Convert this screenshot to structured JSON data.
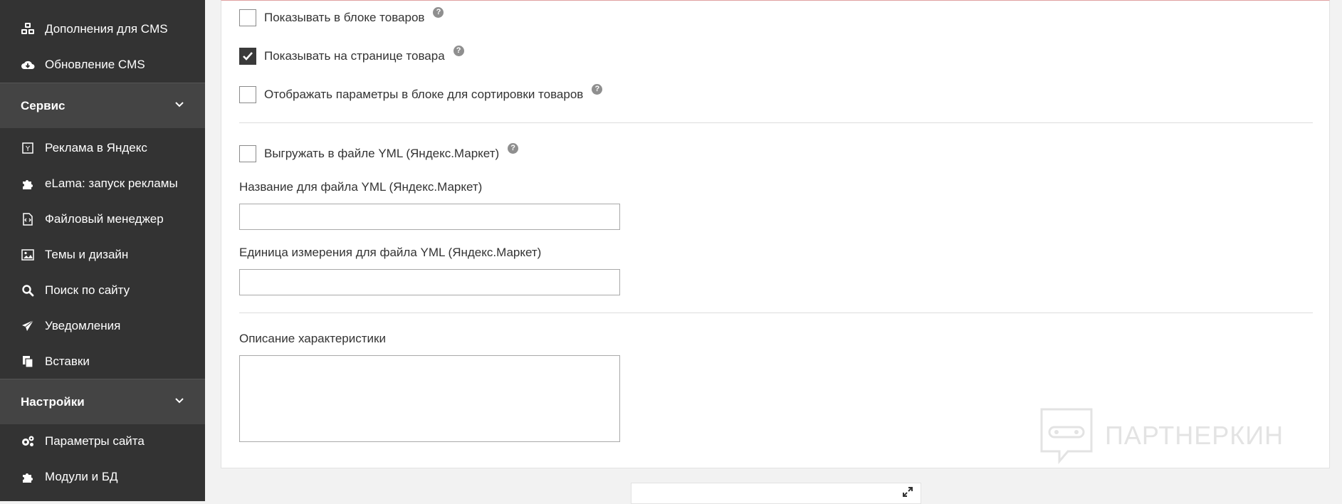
{
  "sidebar": {
    "top_items": [
      {
        "label": "Дополнения для CMS",
        "icon": "cubes-icon"
      },
      {
        "label": "Обновление CMS",
        "icon": "cloud-download-icon"
      }
    ],
    "sections": [
      {
        "title": "Сервис",
        "items": [
          {
            "label": "Реклама в Яндекс",
            "icon": "yandex-icon"
          },
          {
            "label": "eLama: запуск рекламы",
            "icon": "puzzle-icon"
          },
          {
            "label": "Файловый менеджер",
            "icon": "file-code-icon"
          },
          {
            "label": "Темы и дизайн",
            "icon": "image-icon"
          },
          {
            "label": "Поиск по сайту",
            "icon": "search-icon"
          },
          {
            "label": "Уведомления",
            "icon": "paper-plane-icon"
          },
          {
            "label": "Вставки",
            "icon": "copy-icon"
          }
        ]
      },
      {
        "title": "Настройки",
        "items": [
          {
            "label": "Параметры сайта",
            "icon": "gears-icon"
          },
          {
            "label": "Модули и БД",
            "icon": "puzzle-icon"
          }
        ]
      }
    ]
  },
  "form": {
    "checkboxes": [
      {
        "label": "Показывать в блоке товаров",
        "checked": false
      },
      {
        "label": "Показывать на странице товара",
        "checked": true
      },
      {
        "label": "Отображать параметры в блоке для сортировки товаров",
        "checked": false
      },
      {
        "label": "Выгружать в файле YML (Яндекс.Маркет)",
        "checked": false
      }
    ],
    "help_glyph": "?",
    "yml_name_label": "Название для файла YML (Яндекс.Маркет)",
    "yml_name_value": "",
    "yml_unit_label": "Единица измерения для файла YML (Яндекс.Маркет)",
    "yml_unit_value": "",
    "description_label": "Описание характеристики",
    "description_value": ""
  },
  "watermark": {
    "text": "ПАРТНЕРКИН"
  },
  "colors": {
    "sidebar_bg": "#333333",
    "section_bg": "#444444",
    "checked_bg": "#3a3a3a"
  }
}
